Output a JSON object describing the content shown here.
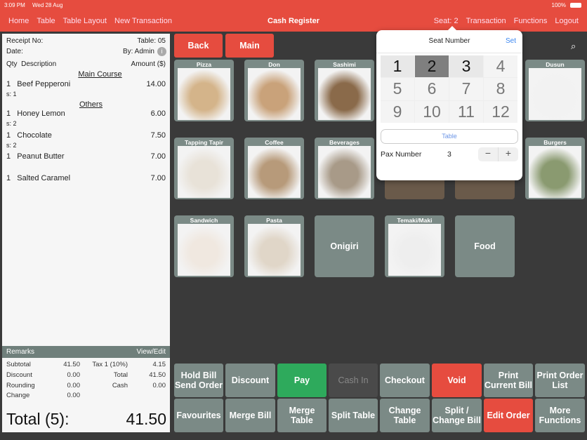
{
  "status": {
    "time": "3:09 PM",
    "date": "Wed 28 Aug",
    "battery": "100%"
  },
  "nav": {
    "left": [
      "Home",
      "Table",
      "Table Layout",
      "New Transaction"
    ],
    "title": "Cash Register",
    "right": [
      "Seat: 2",
      "Transaction",
      "Functions",
      "Logout"
    ]
  },
  "receipt": {
    "receipt_no": "Receipt No:",
    "table": "Table: 05",
    "date": "Date:",
    "by": "By: Admin",
    "qty": "Qty",
    "desc": "Description",
    "amount": "Amount ($)",
    "sections": [
      {
        "title": "Main Course"
      },
      {
        "title": "Others"
      }
    ],
    "items": [
      {
        "qty": "1",
        "name": "Beef Pepperoni",
        "amount": "14.00",
        "seat": "s: 1"
      },
      {
        "qty": "1",
        "name": "Honey Lemon",
        "amount": "6.00",
        "seat": "s: 2"
      },
      {
        "qty": "1",
        "name": "Chocolate",
        "amount": "7.50",
        "seat": "s: 2"
      },
      {
        "qty": "1",
        "name": "Peanut Butter",
        "amount": "7.00",
        "seat": ""
      },
      {
        "qty": "1",
        "name": "Salted Caramel",
        "amount": "7.00",
        "seat": ""
      }
    ],
    "remarks": "Remarks",
    "view_edit": "View/Edit",
    "totals": {
      "subtotal_l": "Subtotal",
      "subtotal": "41.50",
      "discount_l": "Discount",
      "discount": "0.00",
      "rounding_l": "Rounding",
      "rounding": "0.00",
      "change_l": "Change",
      "change": "0.00",
      "tax_l": "Tax 1 (10%)",
      "tax": "4.15",
      "total_l": "Total",
      "total": "41.50",
      "cash_l": "Cash",
      "cash": "0.00"
    },
    "grand_label": "Total (5):",
    "grand": "41.50"
  },
  "top_buttons": {
    "back": "Back",
    "main": "Main"
  },
  "tiles": [
    "Pizza",
    "Don",
    "Sashimi",
    "Dusun",
    "Tapping Tapir",
    "Coffee",
    "Beverages",
    "Burgers",
    "Sandwich",
    "Pasta",
    "Onigiri",
    "Temaki/Maki",
    "Food"
  ],
  "popover": {
    "title": "Seat Number",
    "set": "Set",
    "seats": [
      "1",
      "2",
      "3",
      "4",
      "5",
      "6",
      "7",
      "8",
      "9",
      "10",
      "11",
      "12"
    ],
    "selected": "2",
    "table": "Table",
    "pax_label": "Pax Number",
    "pax": "3",
    "minus": "−",
    "plus": "+"
  },
  "actions": [
    "Hold Bill Send Order",
    "Discount",
    "Pay",
    "Cash In",
    "Checkout",
    "Void",
    "Print Current Bill",
    "Print Order List",
    "Favourites",
    "Merge Bill",
    "Merge Table",
    "Split Table",
    "Change Table",
    "Split / Change Bill",
    "Edit Order",
    "More Functions"
  ],
  "colors": {
    "accent": "#e64c3f",
    "pay": "#2eaa5c",
    "tile": "#7b8a86"
  }
}
